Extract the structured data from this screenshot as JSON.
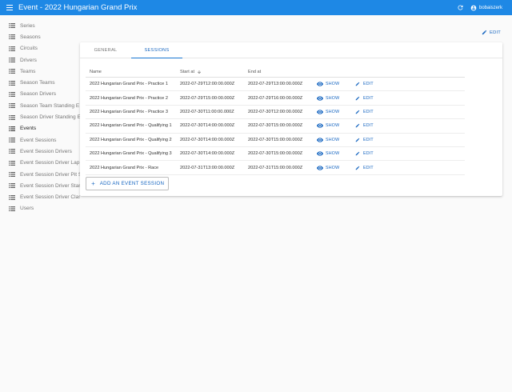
{
  "app": {
    "title": "Event - 2022 Hungarian Grand Prix",
    "username": "bobaiszerk",
    "menu_icon": "menu-icon",
    "refresh_icon": "refresh-icon",
    "user_icon": "account-circle-icon",
    "accent": "#1e88e5"
  },
  "sidebar": {
    "items": [
      {
        "label": "Series"
      },
      {
        "label": "Seasons"
      },
      {
        "label": "Circuits"
      },
      {
        "label": "Drivers"
      },
      {
        "label": "Teams"
      },
      {
        "label": "Season Teams"
      },
      {
        "label": "Season Drivers"
      },
      {
        "label": "Season Team Standing E"
      },
      {
        "label": "Season Driver Standing E"
      },
      {
        "label": "Events",
        "active": true
      },
      {
        "label": "Event Sessions"
      },
      {
        "label": "Event Session Drivers"
      },
      {
        "label": "Event Session Driver Lap"
      },
      {
        "label": "Event Session Driver Pit S"
      },
      {
        "label": "Event Session Driver Stan"
      },
      {
        "label": "Event Session Driver Clas"
      },
      {
        "label": "Users"
      }
    ]
  },
  "toolbar": {
    "edit_label": "EDIT"
  },
  "tabs": [
    {
      "label": "GENERAL",
      "active": false
    },
    {
      "label": "SESSIONS",
      "active": true
    }
  ],
  "table": {
    "columns": {
      "name": "Name",
      "start": "Start at",
      "end": "End at"
    },
    "sort_icon": "arrow-down-icon",
    "show_label": "SHOW",
    "edit_label": "EDIT",
    "rows": [
      {
        "name": "2022 Hungarian Grand Prix - Practice 1",
        "start": "2022-07-29T12:00:00.000Z",
        "end": "2022-07-29T13:00:00.000Z"
      },
      {
        "name": "2022 Hungarian Grand Prix - Practice 2",
        "start": "2022-07-29T15:00:00.000Z",
        "end": "2022-07-29T16:00:00.000Z"
      },
      {
        "name": "2022 Hungarian Grand Prix - Practice 3",
        "start": "2022-07-30T11:00:00.000Z",
        "end": "2022-07-30T12:00:00.000Z"
      },
      {
        "name": "2022 Hungarian Grand Prix - Qualifying 1",
        "start": "2022-07-30T14:00:00.000Z",
        "end": "2022-07-30T15:00:00.000Z"
      },
      {
        "name": "2022 Hungarian Grand Prix - Qualifying 2",
        "start": "2022-07-30T14:00:00.000Z",
        "end": "2022-07-30T15:00:00.000Z"
      },
      {
        "name": "2022 Hungarian Grand Prix - Qualifying 3",
        "start": "2022-07-30T14:00:00.000Z",
        "end": "2022-07-30T15:00:00.000Z"
      },
      {
        "name": "2022 Hungarian Grand Prix - Race",
        "start": "2022-07-31T13:00:00.000Z",
        "end": "2022-07-31T15:00:00.000Z"
      }
    ]
  },
  "add_button": {
    "label": "ADD AN EVENT SESSION"
  }
}
